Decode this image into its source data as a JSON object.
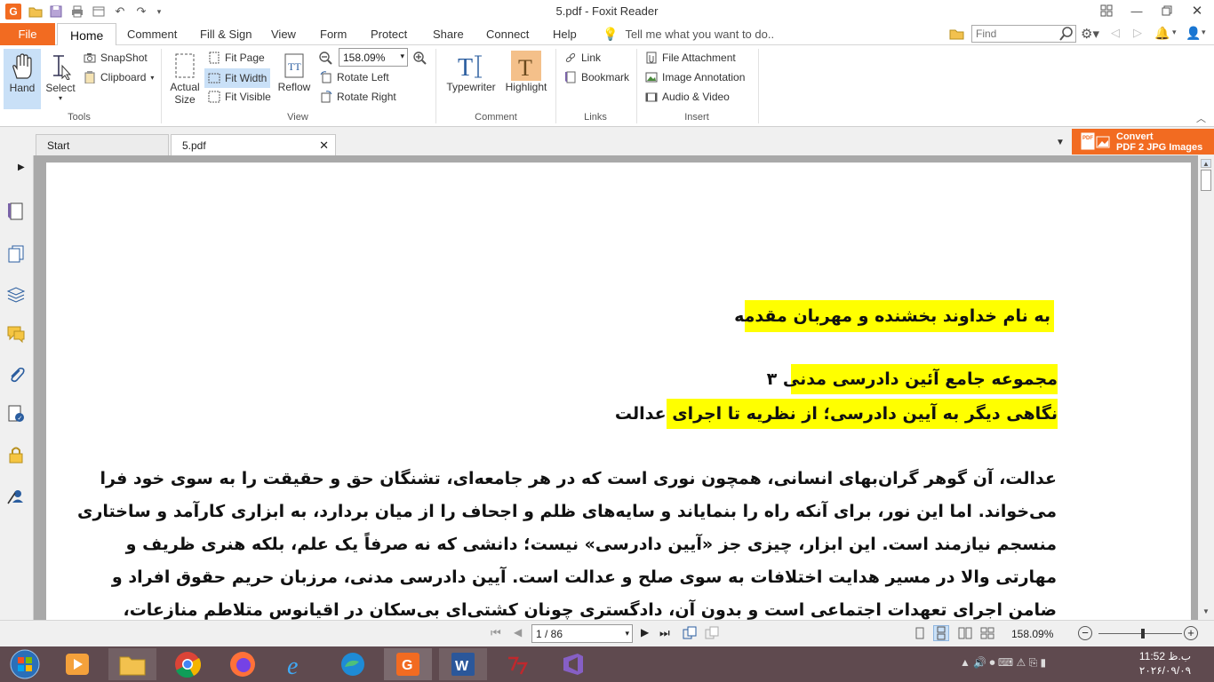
{
  "window": {
    "title": "5.pdf - Foxit Reader",
    "buttons": [
      "restore-layout",
      "minimize",
      "maximize",
      "close"
    ]
  },
  "menu": {
    "file": "File",
    "tabs": [
      "Home",
      "Comment",
      "Fill & Sign",
      "View",
      "Form",
      "Protect",
      "Share",
      "Connect",
      "Help"
    ],
    "active_tab": "Home",
    "tell_me": "Tell me what you want to do..",
    "find_placeholder": "Find"
  },
  "ribbon": {
    "tools": {
      "label": "Tools",
      "hand": "Hand",
      "select": "Select",
      "snapshot": "SnapShot",
      "clipboard": "Clipboard"
    },
    "view": {
      "label": "View",
      "actual_size_line1": "Actual",
      "actual_size_line2": "Size",
      "fit_page": "Fit Page",
      "fit_width": "Fit Width",
      "fit_visible": "Fit Visible",
      "reflow": "Reflow",
      "zoom_value": "158.09%",
      "rotate_left": "Rotate Left",
      "rotate_right": "Rotate Right"
    },
    "comment": {
      "label": "Comment",
      "typewriter": "Typewriter",
      "highlight": "Highlight"
    },
    "links": {
      "label": "Links",
      "link": "Link",
      "bookmark": "Bookmark"
    },
    "insert": {
      "label": "Insert",
      "file_attachment": "File Attachment",
      "image_annotation": "Image Annotation",
      "audio_video": "Audio & Video"
    }
  },
  "doc_tabs": [
    "Start",
    "5.pdf"
  ],
  "convert": {
    "line1": "Convert",
    "line2": "PDF 2 JPG Images"
  },
  "document": {
    "heading1": "به نام خداوند بخشنده و مهربان       مقدمه",
    "heading2": "مجموعه جامع آئین دادرسی مدنی ۳",
    "heading3": "نگاهی دیگر به آیین دادرسی؛ از نظریه تا اجرای عدالت",
    "paragraph": [
      "عدالت، آن گوهر گران‌بهای انسانی، همچون نوری است که در هر جامعه‌ای، تشنگان حق و حقیقت را به سوی خود فرا",
      "می‌خواند. اما این نور، برای آنکه راه را بنمایاند و سایه‌های ظلم و اجحاف را از میان بردارد، به ابزاری کارآمد و ساختاری",
      "منسجم نیازمند است. این ابزار، چیزی جز «آیین دادرسی» نیست؛ دانشی که نه صرفاً یک علم، بلکه هنری ظریف و",
      "مهارتی والا در مسیر هدایت اختلافات به سوی صلح و عدالت است. آیین دادرسی مدنی، مرزبان حریم حقوق افراد و",
      "ضامن اجرای تعهدات اجتماعی است و بدون آن، دادگستری چونان کشتی‌ای بی‌سکان در اقیانوس متلاطم منازعات،"
    ]
  },
  "status": {
    "page": "1 / 86",
    "zoom": "158.09%"
  },
  "taskbar": {
    "time": "11:52 ب.ظ",
    "date": "۲۰۲۶/۰۹/۰۹"
  },
  "colors": {
    "accent": "#f26b21",
    "highlight": "#ffff00",
    "taskbar": "#5f4a4f"
  }
}
